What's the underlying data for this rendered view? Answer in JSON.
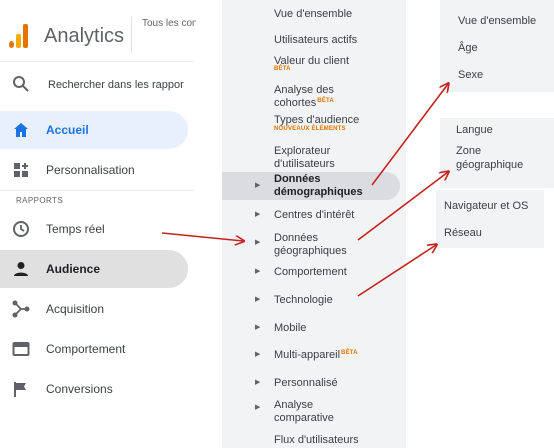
{
  "app": {
    "title": "Analytics",
    "account": "Tous les con"
  },
  "search": {
    "placeholder": "Rechercher dans les rappor"
  },
  "nav": {
    "home": "Accueil",
    "customization": "Personnalisation",
    "section_label": "RAPPORTS",
    "realtime": "Temps réel",
    "audience": "Audience",
    "acquisition": "Acquisition",
    "behavior": "Comportement",
    "conversions": "Conversions"
  },
  "submenu": {
    "items": [
      {
        "label": "Vue d'ensemble"
      },
      {
        "label": "Utilisateurs actifs"
      },
      {
        "label": "Valeur du client",
        "badge": "BÊTA"
      },
      {
        "label_line1": "Analyse des",
        "label_line2": "cohortes",
        "badge": "BÊTA"
      },
      {
        "label": "Types d'audience",
        "badge": "NOUVEAUX ÉLÉMENTS"
      },
      {
        "label_line1": "Explorateur",
        "label_line2": "d'utilisateurs"
      },
      {
        "label_line1": "Données",
        "label_line2": "démographiques"
      },
      {
        "label": "Centres d'intérêt"
      },
      {
        "label_line1": "Données",
        "label_line2": "géographiques"
      },
      {
        "label": "Comportement"
      },
      {
        "label": "Technologie"
      },
      {
        "label": "Mobile"
      },
      {
        "label": "Multi-appareil",
        "badge": "BÊTA"
      },
      {
        "label": "Personnalisé"
      },
      {
        "label_line1": "Analyse",
        "label_line2": "comparative"
      },
      {
        "label": "Flux d'utilisateurs"
      }
    ]
  },
  "panels": {
    "demographics": [
      "Vue d'ensemble",
      "Âge",
      "Sexe"
    ],
    "geo": [
      "Langue",
      "Zone",
      "géographique"
    ],
    "technology": [
      "Navigateur et OS",
      "Réseau"
    ]
  },
  "colors": {
    "accent": "#1a73e8",
    "arrow": "#c5221f",
    "badge": "#e37400"
  }
}
